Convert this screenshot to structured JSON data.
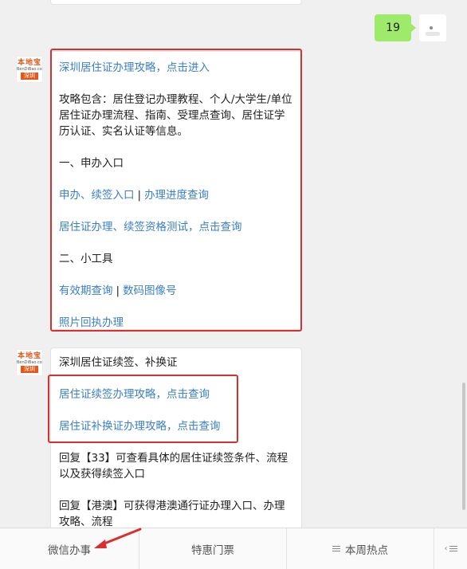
{
  "user_message": {
    "text": "19"
  },
  "bot": {
    "avatar": {
      "logo_text": "本地宝",
      "logo_sub": "BenDiBao.com",
      "city": "深圳"
    }
  },
  "message1": {
    "title_link": "深圳居住证办理攻略，点击进入",
    "intro": "攻略包含：居住登记办理教程、个人/大学生/单位居住证办理流程、指南、受理点查询、居住证学历认证、实名认证等信息。",
    "section1_heading": "一、申办入口",
    "link_apply": "申办、续签入口",
    "separator": "|",
    "link_progress": "办理进度查询",
    "link_test": "居住证办理、续签资格测试，点击查询",
    "section2_heading": "二、小工具",
    "link_validity": "有效期查询",
    "link_photo_code": "数码图像号",
    "link_photo_receipt": "照片回执办理"
  },
  "message2": {
    "title": "深圳居住证续签、补换证",
    "link_renew": "居住证续签办理攻略，点击查询",
    "link_replace": "居住证补换证办理攻略，点击查询",
    "reply_33": "回复【33】可查看具体的居住证续签条件、流程以及获得续签入口",
    "reply_gangao": "回复【港澳】可获得港澳通行证办理入口、办理攻略、流程"
  },
  "menu": {
    "item1": "微信办事",
    "item2": "特惠门票",
    "item3": "本周热点"
  },
  "colors": {
    "link": "#3a7fc5",
    "highlight": "#d9302e",
    "user_bubble": "#9eea6a"
  }
}
